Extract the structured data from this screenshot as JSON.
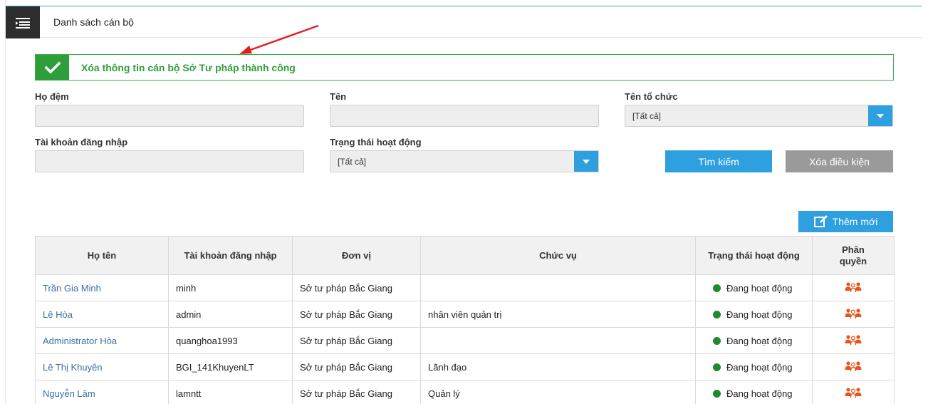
{
  "header": {
    "menu_icon": "hamburger-menu-icon",
    "title": "Danh sách cán bộ"
  },
  "alert": {
    "icon": "check-icon",
    "message": "Xóa thông tin cán bộ Sở Tư pháp thành công",
    "color": "#2e9e3a"
  },
  "filters": {
    "ho_dem_label": "Họ đệm",
    "ho_dem_value": "",
    "ten_label": "Tên",
    "ten_value": "",
    "to_chuc_label": "Tên tổ chức",
    "to_chuc_value": "[Tất cả]",
    "tai_khoan_label": "Tài khoản đăng nhập",
    "tai_khoan_value": "",
    "trang_thai_label": "Trạng thái hoạt động",
    "trang_thai_value": "[Tất cả]"
  },
  "buttons": {
    "search": "Tìm kiếm",
    "clear": "Xóa điều kiện",
    "add": "Thêm mới",
    "add_icon": "edit-icon"
  },
  "table": {
    "columns": [
      "Họ tên",
      "Tài khoản đăng nhập",
      "Đơn vị",
      "Chức vụ",
      "Trạng thái hoạt động",
      "Phân quyền"
    ],
    "rows": [
      {
        "name": "Trần Gia Minh",
        "account": "minh",
        "unit": "Sở tư pháp Bắc Giang",
        "position": "",
        "status": "Đang hoạt động"
      },
      {
        "name": "Lê Hòa",
        "account": "admin",
        "unit": "Sở tư pháp Bắc Giang",
        "position": "nhân viên quản trị",
        "status": "Đang hoạt động"
      },
      {
        "name": "Administrator Hòa",
        "account": "quanghoa1993",
        "unit": "Sở tư pháp Bắc Giang",
        "position": "",
        "status": "Đang hoạt động"
      },
      {
        "name": "Lê Thị Khuyên",
        "account": "BGI_141KhuyenLT",
        "unit": "Sở tư pháp Bắc Giang",
        "position": "Lãnh đạo",
        "status": "Đang hoạt động"
      },
      {
        "name": "Nguyễn Lâm",
        "account": "lamntt",
        "unit": "Sở tư pháp Bắc Giang",
        "position": "Quản lý",
        "status": "Đang hoạt động"
      }
    ],
    "status_color": "#1e8c2b",
    "perm_icon": "user-group-permission-icon",
    "perm_color": "#e8541e"
  },
  "colors": {
    "primary": "#2e9fdf",
    "secondary_button": "#9a9a9a",
    "annotation_arrow": "#e02020"
  }
}
